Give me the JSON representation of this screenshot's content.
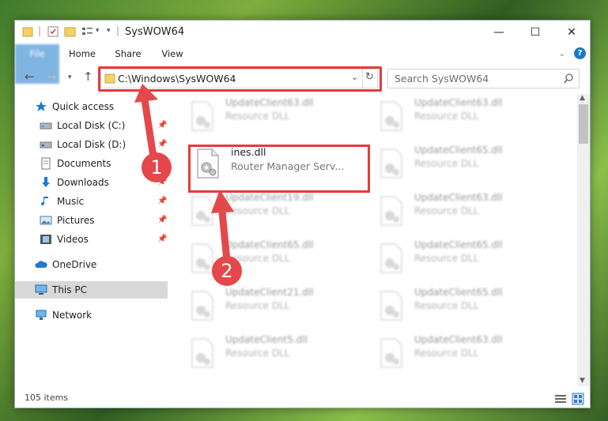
{
  "window": {
    "title": "SysWOW64"
  },
  "ribbon": {
    "tabs": [
      "File",
      "Home",
      "Share",
      "View"
    ]
  },
  "address": {
    "path": "C:\\Windows\\SysWOW64"
  },
  "search": {
    "placeholder": "Search SysWOW64"
  },
  "sidebar": {
    "items": [
      {
        "label": "Quick access",
        "icon": "star-icon"
      },
      {
        "label": "Local Disk (C:)",
        "icon": "drive-icon"
      },
      {
        "label": "Local Disk (D:)",
        "icon": "drive-icon"
      },
      {
        "label": "Documents",
        "icon": "documents-icon"
      },
      {
        "label": "Downloads",
        "icon": "download-icon"
      },
      {
        "label": "Music",
        "icon": "music-icon"
      },
      {
        "label": "Pictures",
        "icon": "pictures-icon"
      },
      {
        "label": "Videos",
        "icon": "videos-icon"
      },
      {
        "label": "OneDrive",
        "icon": "cloud-icon"
      },
      {
        "label": "This PC",
        "icon": "computer-icon"
      },
      {
        "label": "Network",
        "icon": "network-icon"
      }
    ]
  },
  "files": [
    {
      "name": "UpdateClient63.dll",
      "desc": "Resource DLL"
    },
    {
      "name": "UpdateClient63.dll",
      "desc": "Resource DLL"
    },
    {
      "name": "ines.dll",
      "desc": "Router Manager Serv..."
    },
    {
      "name": "UpdateClient65.dll",
      "desc": "Resource DLL"
    },
    {
      "name": "UpdateClient19.dll",
      "desc": "Resource DLL"
    },
    {
      "name": "UpdateClient63.dll",
      "desc": "Resource DLL"
    },
    {
      "name": "UpdateClient65.dll",
      "desc": "Resource DLL"
    },
    {
      "name": "UpdateClient65.dll",
      "desc": "Resource DLL"
    },
    {
      "name": "UpdateClient21.dll",
      "desc": "Resource DLL"
    },
    {
      "name": "UpdateClient65.dll",
      "desc": "Resource DLL"
    },
    {
      "name": "UpdateClient5.dll",
      "desc": "Resource DLL"
    },
    {
      "name": "UpdateClient63.dll",
      "desc": "Resource DLL"
    }
  ],
  "status": {
    "count": "105 items"
  },
  "annotations": {
    "one": "1",
    "two": "2"
  }
}
